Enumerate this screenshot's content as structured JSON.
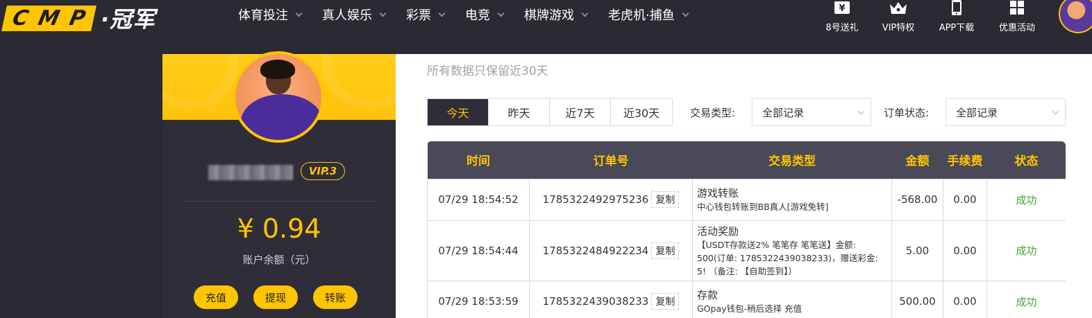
{
  "brand": {
    "logo_letters": [
      "C",
      "M",
      "P"
    ],
    "logo_text": "·冠军",
    "accent_color": "#ffc500",
    "dark_bg": "#2b2a33"
  },
  "nav": {
    "items": [
      {
        "label": "体育投注"
      },
      {
        "label": "真人娱乐"
      },
      {
        "label": "彩票"
      },
      {
        "label": "电竞"
      },
      {
        "label": "棋牌游戏"
      },
      {
        "label": "老虎机·捕鱼"
      }
    ],
    "quick_links": [
      {
        "label": "8号送礼",
        "icon": "gift-yen-icon"
      },
      {
        "label": "VIP特权",
        "icon": "crown-icon"
      },
      {
        "label": "APP下载",
        "icon": "phone-icon"
      },
      {
        "label": "优惠活动",
        "icon": "promo-grid-icon"
      }
    ]
  },
  "profile": {
    "vip_level": "VIP.3",
    "balance": "¥ 0.94",
    "balance_label": "账户余额（元）",
    "buttons": {
      "deposit": "充值",
      "withdraw": "提现",
      "transfer": "转账"
    }
  },
  "content": {
    "note": "所有数据只保留近30天",
    "tabs": [
      {
        "label": "今天",
        "active": true
      },
      {
        "label": "昨天",
        "active": false
      },
      {
        "label": "近7天",
        "active": false
      },
      {
        "label": "近30天",
        "active": false
      }
    ],
    "filters": {
      "type_label": "交易类型:",
      "type_value": "全部记录",
      "status_label": "订单状态:",
      "status_value": "全部记录"
    },
    "table": {
      "headers": {
        "time": "时间",
        "order": "订单号",
        "type": "交易类型",
        "amount": "金额",
        "fee": "手续费",
        "status": "状态"
      },
      "copy_label": "复制",
      "rows": [
        {
          "time": "07/29 18:54:52",
          "order": "1785322492975236",
          "type_title": "游戏转账",
          "type_desc": "中心钱包转账到BB真人[游戏免转]",
          "amount": "-568.00",
          "fee": "0.00",
          "status": "成功"
        },
        {
          "time": "07/29 18:54:44",
          "order": "1785322484922234",
          "type_title": "活动奖励",
          "type_desc": "【USDT存款送2% 笔笔存 笔笔送】金额: 500(订单: 1785322439038233)，赠送彩金: 5! （备注: 【自助签到】）",
          "amount": "5.00",
          "fee": "0.00",
          "status": "成功"
        },
        {
          "time": "07/29 18:53:59",
          "order": "1785322439038233",
          "type_title": "存款",
          "type_desc": "GOpay钱包-稍后选择 充值",
          "amount": "500.00",
          "fee": "0.00",
          "status": "成功"
        }
      ]
    }
  }
}
